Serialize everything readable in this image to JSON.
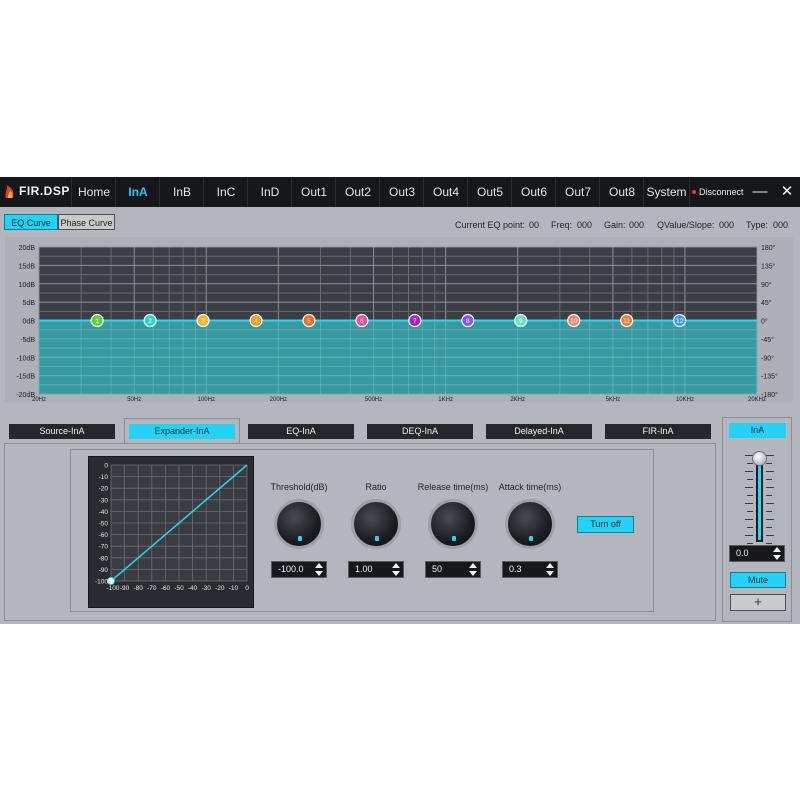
{
  "app": {
    "logo_text": "FIR.DSP",
    "nav_tabs": [
      "Home",
      "InA",
      "InB",
      "InC",
      "InD",
      "Out1",
      "Out2",
      "Out3",
      "Out4",
      "Out5",
      "Out6",
      "Out7",
      "Out8",
      "System"
    ],
    "active_tab": "InA",
    "disconnect_label": "Disconnect",
    "minimize_glyph": "—",
    "close_glyph": "✕"
  },
  "curve_buttons": {
    "eq_curve": "EQ Curve",
    "phase_curve": "Phase Curve",
    "active": "EQ Curve"
  },
  "eq_info": {
    "current_label": "Current EQ point:",
    "current_value": "00",
    "freq_label": "Freq:",
    "freq_value": "000",
    "gain_label": "Gain:",
    "gain_value": "000",
    "q_label": "QValue/Slope:",
    "q_value": "000",
    "type_label": "Type:",
    "type_value": "000"
  },
  "eq_graph": {
    "y_left_labels": [
      "20dB",
      "15dB",
      "10dB",
      "5dB",
      "0dB",
      "-5dB",
      "-10dB",
      "-15dB",
      "-20dB"
    ],
    "y_right_labels": [
      "180°",
      "135°",
      "90°",
      "45°",
      "0°",
      "-45°",
      "-90°",
      "-135°",
      "-180°"
    ],
    "x_labels": [
      "20Hz",
      "50Hz",
      "100Hz",
      "200Hz",
      "500Hz",
      "1KHz",
      "2KHz",
      "5KHz",
      "10KHz",
      "20KHz"
    ],
    "x_label_freqs": [
      20,
      50,
      100,
      200,
      500,
      1000,
      2000,
      5000,
      10000,
      20000
    ],
    "gain_db": 0,
    "points": [
      {
        "label": "1",
        "color": "#5fd23a"
      },
      {
        "label": "2",
        "color": "#2fd0d6"
      },
      {
        "label": "3",
        "color": "#f2b431"
      },
      {
        "label": "4",
        "color": "#f29c22"
      },
      {
        "label": "5",
        "color": "#f26a2a"
      },
      {
        "label": "6",
        "color": "#ee4ca0"
      },
      {
        "label": "7",
        "color": "#a324cc"
      },
      {
        "label": "8",
        "color": "#8a55ee"
      },
      {
        "label": "9",
        "color": "#66e2c4"
      },
      {
        "label": "10",
        "color": "#f2826a"
      },
      {
        "label": "11",
        "color": "#f07a3a"
      },
      {
        "label": "12",
        "color": "#3a9cf0"
      }
    ],
    "fill_color": "#38a9b0",
    "line_color": "#27d6f2"
  },
  "module_tabs": [
    "Source-InA",
    "Expander-InA",
    "EQ-InA",
    "DEQ-InA",
    "Delayed-InA",
    "FIR-InA"
  ],
  "active_module": "Expander-InA",
  "expander": {
    "x_ticks": [
      "-100",
      "-90",
      "-80",
      "-70",
      "-60",
      "-50",
      "-40",
      "-30",
      "-20",
      "-10",
      "0"
    ],
    "y_ticks": [
      "0",
      "-10",
      "-20",
      "-30",
      "-40",
      "-50",
      "-60",
      "-70",
      "-80",
      "-90",
      "-100"
    ],
    "threshold_label": "Threshold(dB)",
    "threshold_value": "-100.0",
    "ratio_label": "Ratio",
    "ratio_value": "1.00",
    "release_label": "Release time(ms)",
    "release_value": "50",
    "attack_label": "Attack time(ms)",
    "attack_value": "0.3",
    "turn_off_label": "Turn off"
  },
  "channel_strip": {
    "label": "InA",
    "gain_value": "0.0",
    "mute_label": "Mute",
    "plus_label": "+",
    "fader_level": 1.0
  },
  "colors": {
    "accent": "#24d2f5",
    "bar_bg": "#16171b",
    "panel_bg": "#b4b6bd"
  }
}
